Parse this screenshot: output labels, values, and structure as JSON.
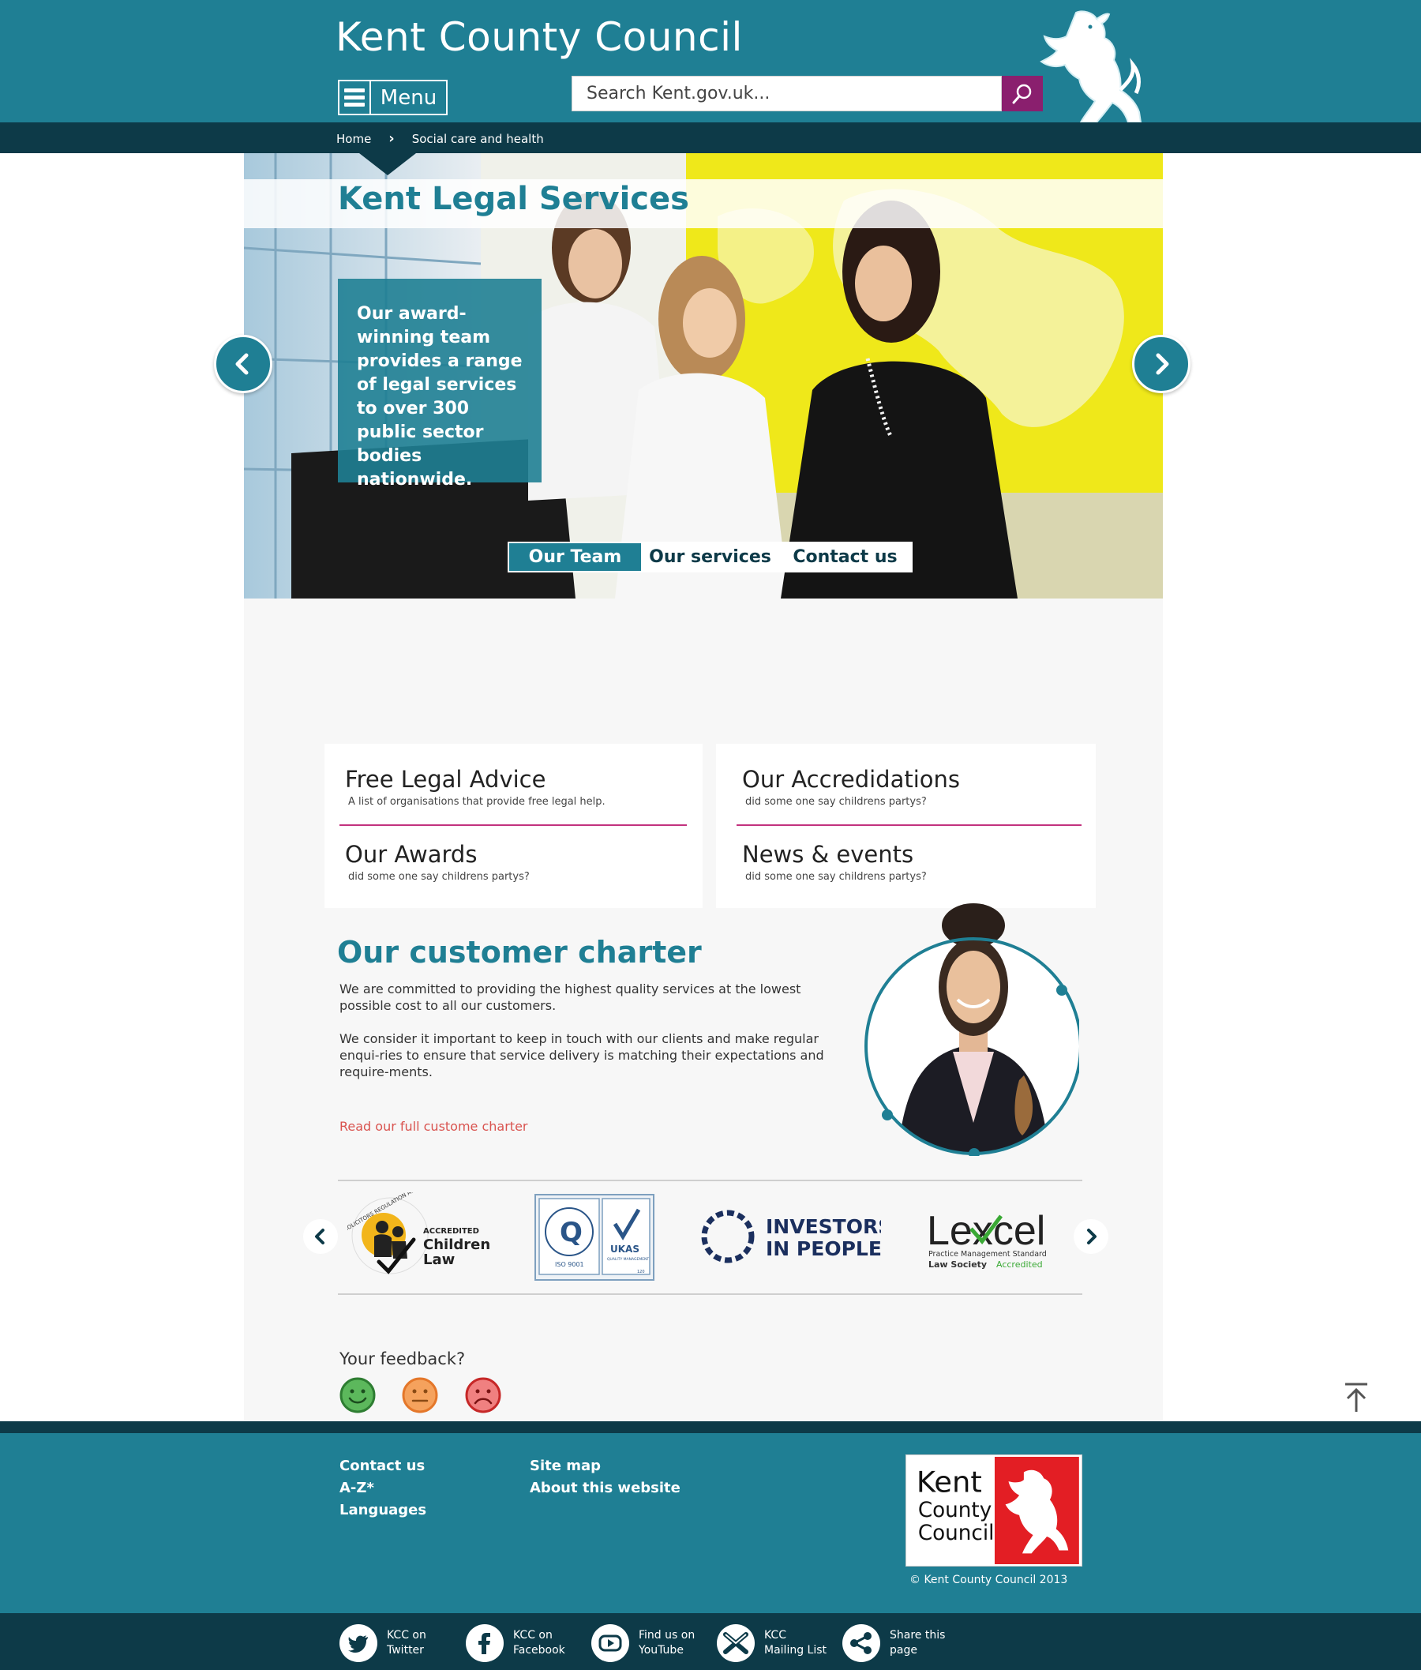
{
  "header": {
    "site_title": "Kent County Council",
    "menu_label": "Menu",
    "search_placeholder": "Search Kent.gov.uk..."
  },
  "breadcrumb": [
    "Home",
    "Social care and health"
  ],
  "hero": {
    "title": "Kent Legal Services",
    "caption": "Our award-winning team provides a range of legal services to over 300 public sector bodies nationwide.",
    "tabs": [
      {
        "label": "Our Team",
        "active": true
      },
      {
        "label": "Our services",
        "active": false
      },
      {
        "label": "Contact us",
        "active": false
      }
    ]
  },
  "cards": [
    {
      "title": "Free Legal Advice",
      "subtitle": "A list of organisations that provide free legal help."
    },
    {
      "title": "Our Accredidations",
      "subtitle": "did some one say childrens partys?"
    },
    {
      "title": "Our Awards",
      "subtitle": "did some one say childrens partys?"
    },
    {
      "title": "News & events",
      "subtitle": "did some one say childrens partys?"
    }
  ],
  "charter": {
    "title": "Our customer charter",
    "para1": "We are committed to providing the highest quality services at the lowest possible cost to all our customers.",
    "para2": "We consider it important to keep in touch with our clients and make regular enqui-ries to ensure that service delivery is matching their expectations and require-ments.",
    "link": "Read our full custome charter"
  },
  "accreditations": {
    "children_law": {
      "ring": "SOLICITORS REGULATION AUTHORITY",
      "line1": "ACCREDITED",
      "line2": "Children",
      "line3": "Law"
    },
    "iso": {
      "left": "ISO 9001",
      "right": "UKAS",
      "sub": "QUALITY MANAGEMENT",
      "num": "120"
    },
    "iip": {
      "line1": "INVESTORS",
      "line2": "IN PEOPLE"
    },
    "lexcel": {
      "word": "Lexcel",
      "line1": "Practice Management Standard",
      "line2a": "Law Society",
      "line2b": "Accredited"
    }
  },
  "feedback": {
    "label": "Your feedback?"
  },
  "footer": {
    "links_col1": [
      "Contact us",
      "A-Z*",
      "Languages"
    ],
    "links_col2": [
      "Site map",
      "About this website"
    ],
    "logo_text": [
      "Kent",
      "County",
      "Council"
    ],
    "copyright": "© Kent County Council 2013"
  },
  "social": [
    {
      "icon": "twitter-icon",
      "line1": "KCC on",
      "line2": "Twitter"
    },
    {
      "icon": "facebook-icon",
      "line1": "KCC on",
      "line2": "Facebook"
    },
    {
      "icon": "youtube-icon",
      "line1": "Find us on",
      "line2": "YouTube"
    },
    {
      "icon": "mail-icon",
      "line1": "KCC",
      "line2": "Mailing List"
    },
    {
      "icon": "share-icon",
      "line1": "Share this",
      "line2": "page"
    }
  ],
  "colors": {
    "primary": "#1f7f94",
    "dark": "#0d3a48",
    "accent": "#8a1f6e",
    "divider": "#c2327e",
    "link": "#d9534f"
  }
}
